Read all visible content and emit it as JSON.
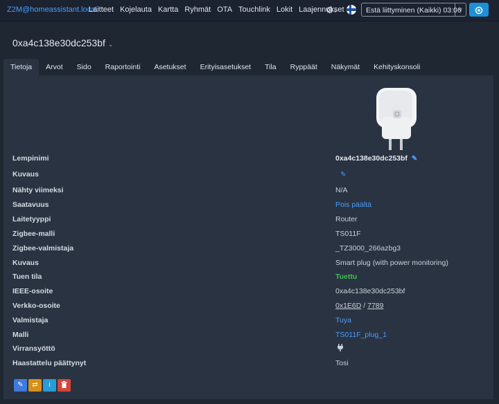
{
  "navbar": {
    "brand": "Z2M@homeassistant.local",
    "links": [
      "Laitteet",
      "Kojelauta",
      "Kartta",
      "Ryhmät",
      "OTA",
      "Touchlink",
      "Lokit",
      "Laajennukset"
    ],
    "settings_icon": "gear-icon",
    "language_icon": "finland-flag-icon",
    "permit_join_label": "Estä liittyminen (Kaikki) 03:06",
    "permit_join_caret": "˅",
    "permit_icon": "shield-icon"
  },
  "device": {
    "title": "0xa4c138e30dc253bf",
    "title_caret": "⌄"
  },
  "tabs": [
    "Tietoja",
    "Arvot",
    "Sido",
    "Raportointi",
    "Asetukset",
    "Erityisasetukset",
    "Tila",
    "Ryppäät",
    "Näkymät",
    "Kehityskonsoli"
  ],
  "active_tab": "Tietoja",
  "details": {
    "friendly_name_label": "Lempinimi",
    "friendly_name_value": "0xa4c138e30dc253bf",
    "description_label": "Kuvaus",
    "last_seen_label": "Nähty viimeksi",
    "last_seen_value": "N/A",
    "availability_label": "Saatavuus",
    "availability_value": "Pois päältä",
    "device_type_label": "Laitetyyppi",
    "device_type_value": "Router",
    "zigbee_model_label": "Zigbee-malli",
    "zigbee_model_value": "TS011F",
    "zigbee_manufacturer_label": "Zigbee-valmistaja",
    "zigbee_manufacturer_value": "_TZ3000_266azbg3",
    "description2_label": "Kuvaus",
    "description2_value": "Smart plug (with power monitoring)",
    "support_status_label": "Tuen tila",
    "support_status_value": "Tuettu",
    "ieee_label": "IEEE-osoite",
    "ieee_value": "0xa4c138e30dc253bf",
    "network_label": "Verkko-osoite",
    "network_hex": "0x1E6D",
    "network_sep": " / ",
    "network_dec": "7789",
    "manufacturer_label": "Valmistaja",
    "manufacturer_value": "Tuya",
    "model_label": "Malli",
    "model_value": "TS011F_plug_1",
    "power_source_label": "Virransyöttö",
    "power_source_icon": "plug-icon",
    "interview_label": "Haastattelu päättynyt",
    "interview_value": "Tosi"
  },
  "action_icons": [
    "edit-icon",
    "reconfigure-icon",
    "info-icon",
    "trash-icon"
  ],
  "colors": {
    "link": "#4a9eff",
    "success": "#3fbf4f",
    "panel": "#2a3342",
    "background": "#1f2733"
  }
}
